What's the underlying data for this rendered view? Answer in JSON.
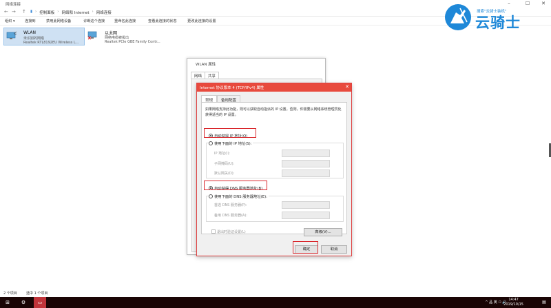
{
  "window": {
    "title": "网络连接",
    "controls": {
      "minimize": "–",
      "maximize": "☐",
      "close": "✕"
    }
  },
  "address": {
    "back": "←",
    "forward": "→",
    "up": "↑",
    "breadcrumbs": [
      "控制面板",
      "网络和 Internet",
      "网络连接"
    ]
  },
  "commandbar": {
    "items": [
      "组织 ▾",
      "连接到",
      "禁用此网络设备",
      "诊断这个连接",
      "重命名此连接",
      "查看此连接的状态",
      "更改此连接的设置"
    ]
  },
  "adapters": [
    {
      "name": "WLAN",
      "status": "未识别的网络",
      "device": "Realtek RTL8192EU Wireless L..."
    },
    {
      "name": "以太网",
      "status": "网络电缆被拔出",
      "device": "Realtek PCIe GBE Family Contr..."
    }
  ],
  "wlan_props": {
    "title": "WLAN 属性",
    "tabs": [
      "网络",
      "共享"
    ]
  },
  "ipv4": {
    "title": "Internet 协议版本 4 (TCP/IPv4) 属性",
    "close": "✕",
    "tabs": [
      "常规",
      "备用配置"
    ],
    "description": "如果网络支持此功能，则可以获取自动指派的 IP 设置。否则，你需要从网络系统管理员处获得适当的 IP 设置。",
    "auto_ip": "自动获得 IP 地址(O)",
    "manual_ip": "使用下面的 IP 地址(S):",
    "ip_address": "IP 地址(I):",
    "subnet": "子网掩码(U):",
    "gateway": "默认网关(D):",
    "auto_dns": "自动获得 DNS 服务器地址(B)",
    "manual_dns": "使用下面的 DNS 服务器地址(E):",
    "preferred_dns": "首选 DNS 服务器(P):",
    "alternate_dns": "备用 DNS 服务器(A):",
    "validate": "退出时验证设置(L)",
    "advanced": "高级(V)...",
    "ok": "确定",
    "cancel": "取消"
  },
  "statusbar": {
    "items_count": "2 个项目",
    "selected": "选中 1 个项目"
  },
  "taskbar": {
    "start": "⊞",
    "settings": "⚙",
    "tray": "^ 品 英 ⚇ 🔊",
    "time": "14:47",
    "date": "2019/10/15",
    "ime": "英"
  },
  "watermark": {
    "slogan": "搜索\"云骑士装机\"",
    "brand": "云骑士"
  },
  "colors": {
    "accent_red": "#e84a3d",
    "highlight_red": "#d9262b",
    "brand_blue": "#1e88d8",
    "taskbar": "#1a0505"
  }
}
